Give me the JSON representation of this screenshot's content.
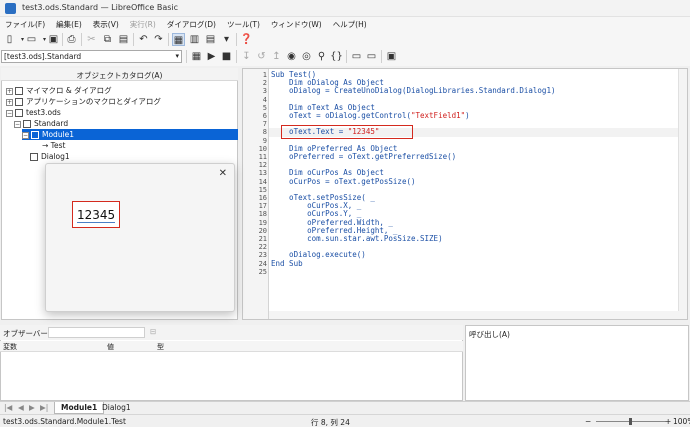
{
  "window": {
    "title": "test3.ods.Standard — LibreOffice Basic"
  },
  "menu": [
    "ファイル(F)",
    "編集(E)",
    "表示(V)",
    "実行(R)",
    "ダイアログ(D)",
    "ツール(T)",
    "ウィンドウ(W)",
    "ヘルプ(H)"
  ],
  "menu_disabled_index": 3,
  "library_selector": {
    "value": "[test3.ods].Standard"
  },
  "catalog": {
    "title": "オブジェクトカタログ(A)",
    "items": [
      {
        "label": "マイマクロ & ダイアログ"
      },
      {
        "label": "アプリケーションのマクロとダイアログ"
      },
      {
        "label": "test3.ods"
      },
      {
        "label": "Standard"
      },
      {
        "label": "Module1"
      },
      {
        "label": "Test"
      },
      {
        "label": "Dialog1"
      }
    ]
  },
  "editor": {
    "line_numbers": [
      "1",
      "2",
      "3",
      "4",
      "5",
      "6",
      "7",
      "8",
      "9",
      "10",
      "11",
      "12",
      "13",
      "14",
      "15",
      "16",
      "17",
      "18",
      "19",
      "20",
      "21",
      "22",
      "23",
      "24",
      "25"
    ],
    "lines": [
      "Sub Test()",
      "    Dim oDialog As Object",
      "    oDialog = CreateUnoDialog(DialogLibraries.Standard.Dialog1)",
      "",
      "    Dim oText As Object",
      "    oText = oDialog.getControl(\"TextField1\")",
      "",
      "    oText.Text = \"12345\"",
      "",
      "    Dim oPreferred As Object",
      "    oPreferred = oText.getPreferredSize()",
      "",
      "    Dim oCurPos As Object",
      "    oCurPos = oText.getPosSize()",
      "",
      "    oText.setPosSize( _",
      "        oCurPos.X, _",
      "        oCurPos.Y, _",
      "        oPreferred.Width, _",
      "        oPreferred.Height, _",
      "        com.sun.star.awt.PosSize.SIZE)",
      "",
      "    oDialog.execute()",
      "End Sub",
      ""
    ]
  },
  "dialog": {
    "textfield_value": "12345",
    "close_glyph": "✕"
  },
  "watch": {
    "label": "オブザーバー(A):",
    "columns": [
      "変数",
      "値",
      "型"
    ]
  },
  "calls": {
    "label": "呼び出し(A)"
  },
  "tabs": [
    "Module1",
    "Dialog1"
  ],
  "status": {
    "path": "test3.ods.Standard.Module1.Test",
    "position": "行 8, 列 24",
    "zoom": "100%"
  },
  "colors": {
    "code": "#1b4fa5",
    "string": "#d0201e",
    "selection": "#0a64d6",
    "highlight_box": "#d42a1e"
  }
}
